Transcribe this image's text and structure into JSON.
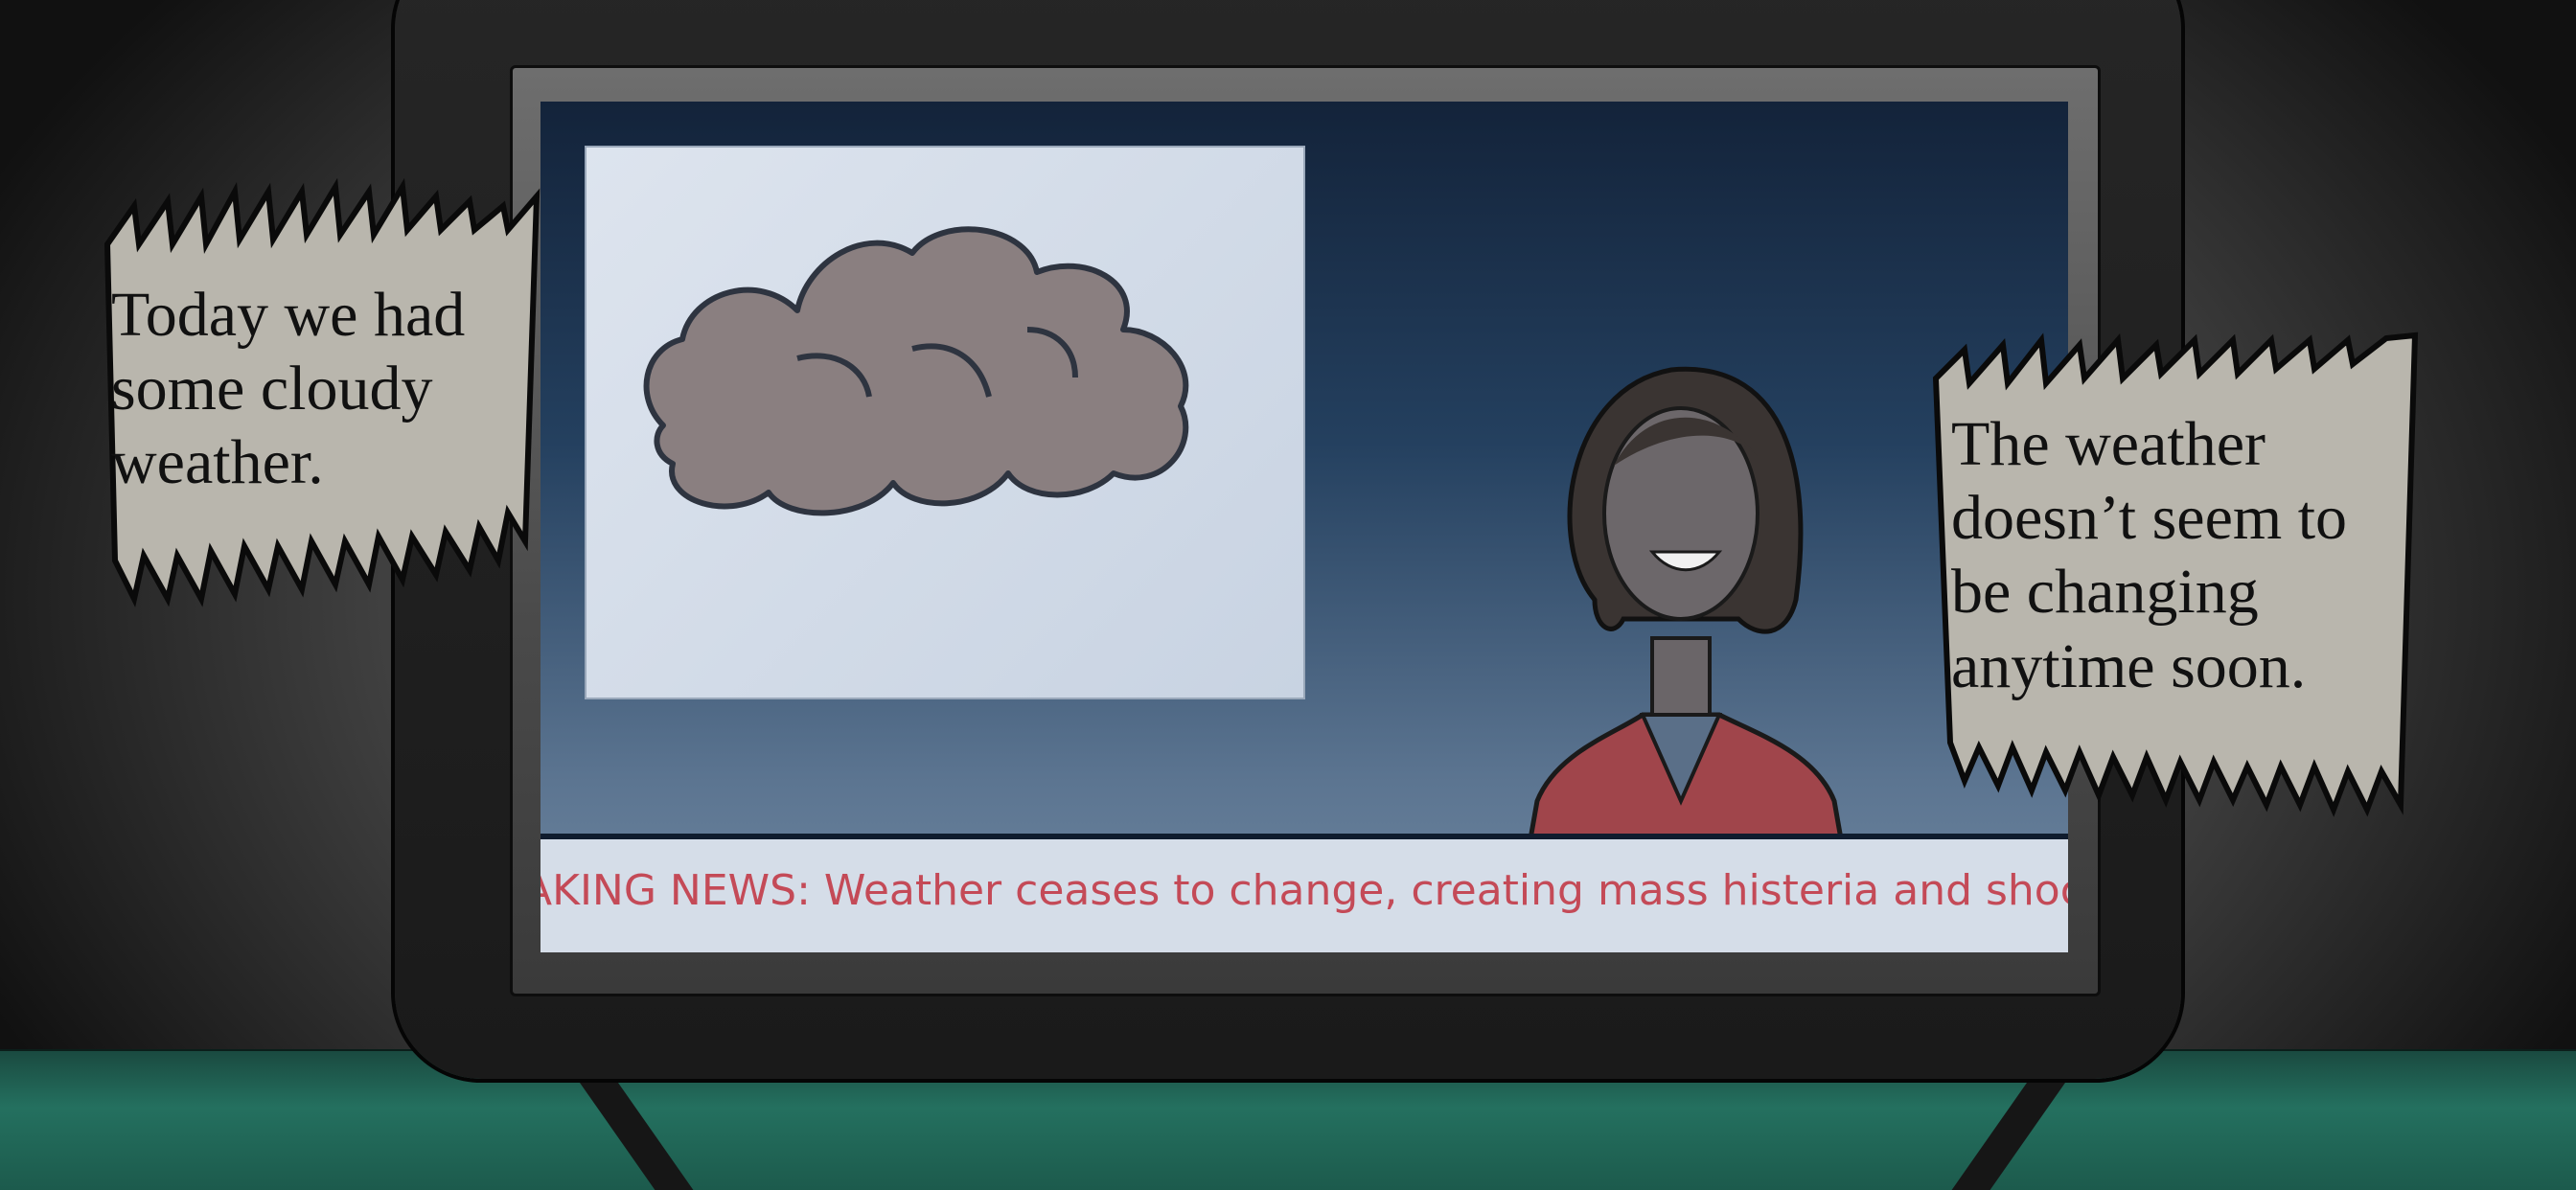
{
  "scene": {
    "speech_left": {
      "lines": [
        "Today we had",
        "some cloudy",
        "weather."
      ]
    },
    "speech_right": {
      "lines": [
        "The weather",
        "doesn’t seem to",
        "be changing",
        "anytime soon."
      ]
    },
    "ticker": {
      "text": "AKING NEWS: Weather ceases to change, creating mass histeria and shock"
    },
    "colors": {
      "screen_top": "#13233a",
      "ticker_text": "#c44a57",
      "jacket": "#a0454b",
      "cloud": "#8a7f80",
      "bubble": "#b9b6ad",
      "floor": "#24705f"
    },
    "icons": {
      "weather": "cloud-icon"
    }
  }
}
